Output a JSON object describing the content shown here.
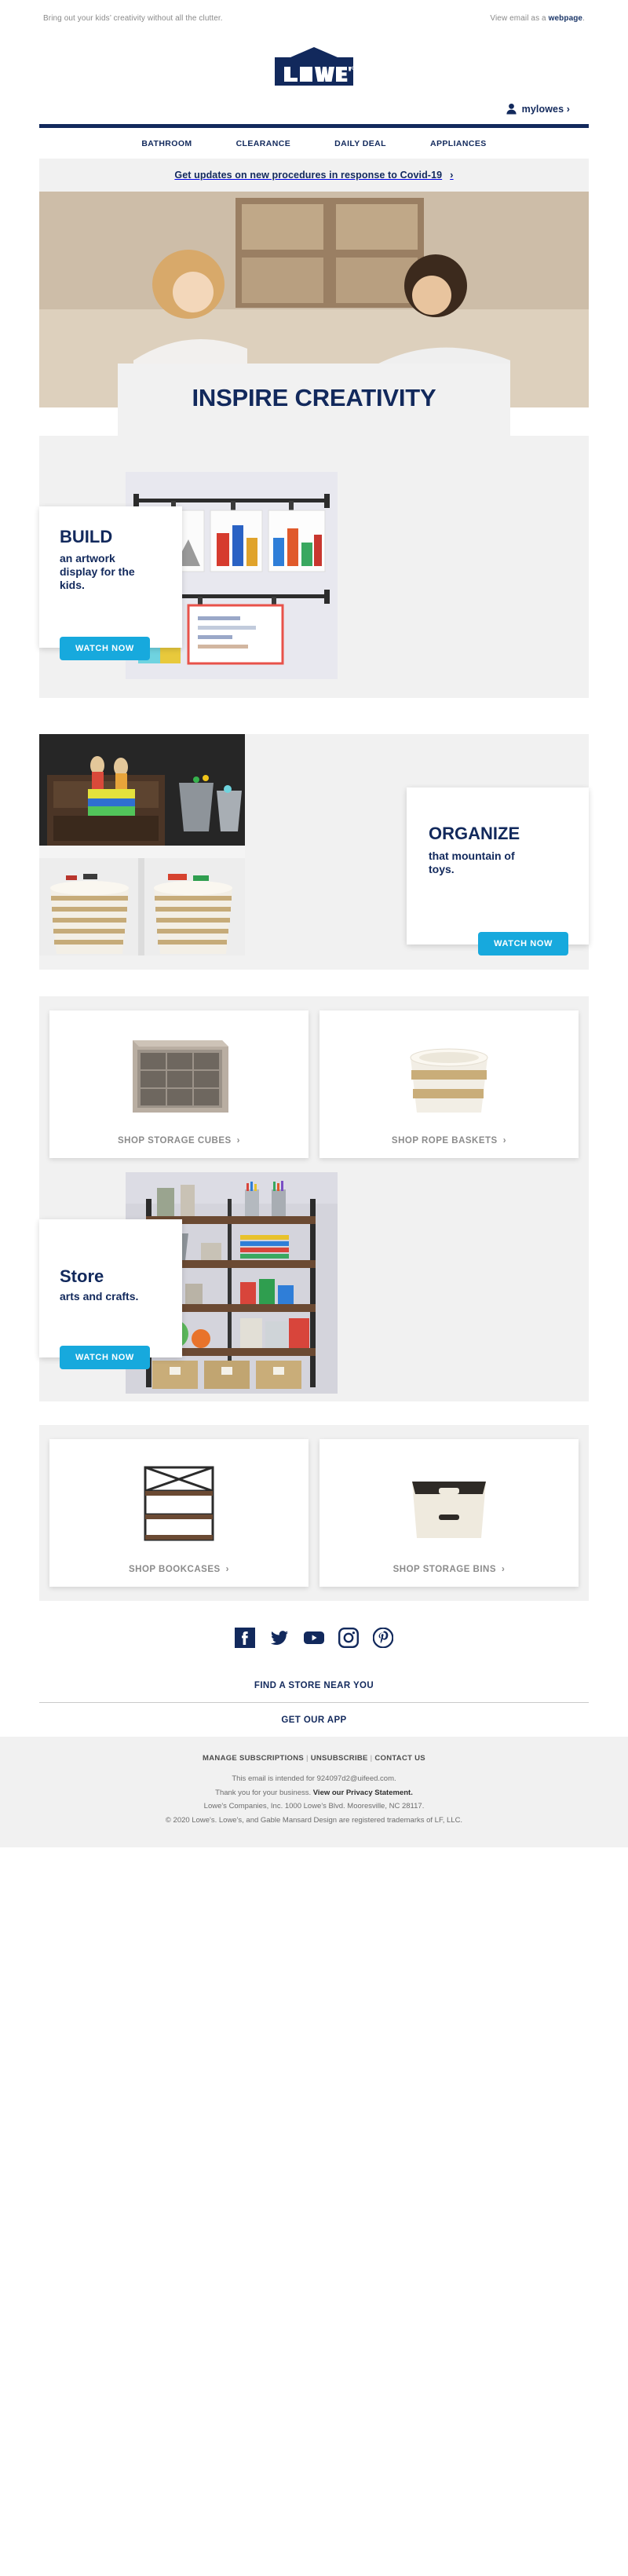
{
  "preheader": {
    "tagline": "Bring out your kids’ creativity without all the clutter.",
    "view_prefix": "View email as a ",
    "view_link": "webpage",
    "view_suffix": "."
  },
  "brand": {
    "name": "LOWE'S",
    "logo_color": "#12295c"
  },
  "account": {
    "label": "mylowes ›"
  },
  "nav": {
    "items": [
      {
        "label": "BATHROOM"
      },
      {
        "label": "CLEARANCE"
      },
      {
        "label": "DAILY DEAL"
      },
      {
        "label": "APPLIANCES"
      }
    ]
  },
  "covid_banner": {
    "text": "Get updates on new procedures in response to Covid-19",
    "chevron": "›"
  },
  "hero": {
    "headline": "INSPIRE CREATIVITY"
  },
  "features": [
    {
      "id": "build",
      "heading": "BUILD",
      "body": "an artwork display for the kids.",
      "cta": "WATCH NOW"
    },
    {
      "id": "organize",
      "heading": "ORGANIZE",
      "body": "that mountain of toys.",
      "cta": "WATCH NOW"
    },
    {
      "id": "store",
      "heading": "Store",
      "body": "arts and crafts.",
      "cta": "WATCH NOW"
    }
  ],
  "tiles_row_one": [
    {
      "label": "SHOP STORAGE CUBES",
      "chevron": "›"
    },
    {
      "label": "SHOP ROPE BASKETS",
      "chevron": "›"
    }
  ],
  "tiles_row_two": [
    {
      "label": "SHOP BOOKCASES",
      "chevron": "›"
    },
    {
      "label": "SHOP STORAGE BINS",
      "chevron": "›"
    }
  ],
  "social": [
    {
      "name": "facebook"
    },
    {
      "name": "twitter"
    },
    {
      "name": "youtube"
    },
    {
      "name": "instagram"
    },
    {
      "name": "pinterest"
    }
  ],
  "footer_links": [
    {
      "label": "FIND A STORE NEAR YOU"
    },
    {
      "label": "GET OUR APP"
    }
  ],
  "legal": {
    "manage": "MANAGE SUBSCRIPTIONS",
    "sep1": "|",
    "unsubscribe": "UNSUBSCRIBE",
    "sep2": "|",
    "contact": "CONTACT US",
    "intended": "This email is intended for 924097d2@uifeed.com.",
    "thanks_prefix": "Thank you for your business. ",
    "privacy": "View our Privacy Statement.",
    "address": "Lowe's Companies, Inc. 1000 Lowe's Blvd. Mooresville, NC 28117.",
    "copyright": "© 2020 Lowe's. Lowe's, and Gable Mansard Design are registered trademarks of LF, LLC."
  },
  "colors": {
    "navy": "#12295c",
    "cyan": "#17a9dd",
    "gray_bg": "#f1f1f1",
    "tile_label": "#8b8b8b"
  }
}
